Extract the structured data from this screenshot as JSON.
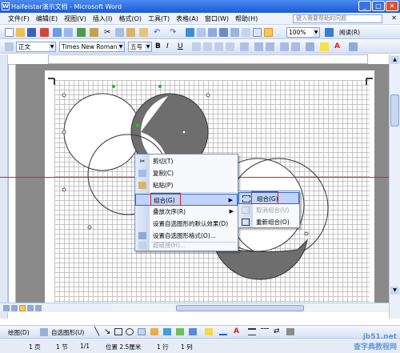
{
  "window": {
    "title": "Haifeistar演示文档 - Microsoft Word"
  },
  "menubar": {
    "items": [
      "文件(F)",
      "编辑(E)",
      "视图(V)",
      "插入(I)",
      "格式(O)",
      "工具(T)",
      "表格(A)",
      "窗口(W)",
      "帮助(H)"
    ],
    "help_placeholder": "键入需要帮助的问题"
  },
  "toolbar": {
    "zoom": "100%",
    "read_label": "阅读(R)",
    "style": "正文",
    "font": "Times New Roman",
    "size": "五号"
  },
  "context_menu": {
    "items": [
      {
        "label": "剪切(T)",
        "icon": "scissors-icon",
        "disabled": false
      },
      {
        "label": "复制(C)",
        "icon": "copy-icon",
        "disabled": false
      },
      {
        "label": "粘贴(P)",
        "icon": "paste-icon",
        "disabled": false
      },
      {
        "label": "组合(G)",
        "icon": "",
        "disabled": false,
        "submenu": true
      },
      {
        "label": "叠放次序(R)",
        "icon": "",
        "disabled": false,
        "submenu": true
      },
      {
        "label": "设置自选图形的默认效果(D)",
        "icon": "",
        "disabled": false
      },
      {
        "label": "设置自选图形格式(O)...",
        "icon": "format-icon",
        "disabled": false
      },
      {
        "label": "超链接(H)...",
        "icon": "hyperlink-icon",
        "disabled": true
      }
    ]
  },
  "submenu": {
    "items": [
      {
        "label": "组合(G)",
        "icon": "group-icon",
        "disabled": false
      },
      {
        "label": "取消组合(U)",
        "icon": "ungroup-icon",
        "disabled": true
      },
      {
        "label": "重新组合(O)",
        "icon": "regroup-icon",
        "disabled": false
      }
    ]
  },
  "drawbar": {
    "draw_label": "绘图(D)",
    "autoshapes_label": "自选图形(U)"
  },
  "statusbar": {
    "page": "1 页",
    "section": "1 节",
    "pages": "1/1",
    "position": "位置 2.5厘米",
    "line": "1 行",
    "col": "1 列"
  },
  "watermark": {
    "line1": "jb51.net",
    "line2": "查字典教程网"
  },
  "colors": {
    "accent": "#316ac5",
    "highlight_red": "#e02020",
    "dark_circle": "#6e6e6e"
  }
}
